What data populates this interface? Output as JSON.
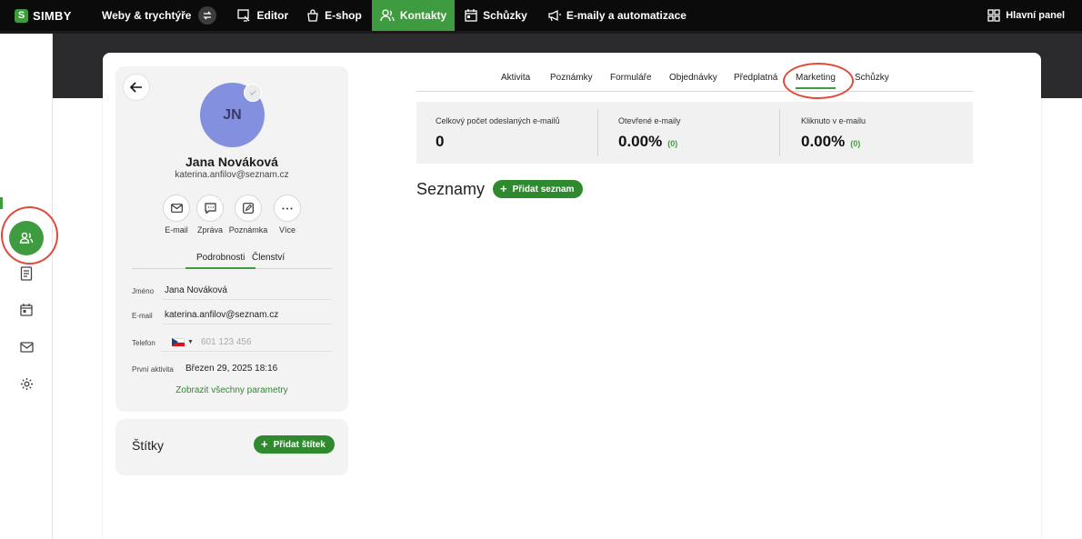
{
  "brand": {
    "name": "SIMBY",
    "badge": "S",
    "accent": "#3f9b3f"
  },
  "topnav": {
    "items": [
      {
        "label": "Weby & trychtýře",
        "icon": "none",
        "active": false
      },
      {
        "label": "Editor",
        "icon": "editor-icon",
        "active": false
      },
      {
        "label": "E-shop",
        "icon": "shopping-bag-icon",
        "active": false
      },
      {
        "label": "Kontakty",
        "icon": "users-icon",
        "active": true
      },
      {
        "label": "Schůzky",
        "icon": "calendar-icon",
        "active": false
      },
      {
        "label": "E-maily a automatizace",
        "icon": "megaphone-icon",
        "active": false
      }
    ],
    "dashboard_label": "Hlavní panel"
  },
  "sidebar": {
    "items": [
      "contacts-icon",
      "document-icon",
      "calendar-icon",
      "mail-icon",
      "gear-icon"
    ]
  },
  "profile": {
    "initials": "JN",
    "name": "Jana Nováková",
    "email": "katerina.anfilov@seznam.cz",
    "actions": [
      {
        "label": "E-mail",
        "icon": "mail-icon"
      },
      {
        "label": "Zpráva",
        "icon": "message-icon"
      },
      {
        "label": "Poznámka",
        "icon": "note-icon"
      },
      {
        "label": "Více",
        "icon": "more-icon"
      }
    ],
    "tabs": {
      "details": "Podrobnosti",
      "membership": "Členství"
    },
    "fields": {
      "name_label": "Jméno",
      "name_value": "Jana Nováková",
      "email_label": "E-mail",
      "email_value": "katerina.anfilov@seznam.cz",
      "phone_label": "Telefon",
      "phone_placeholder": "601 123 456",
      "first_activity_label": "První aktivita",
      "first_activity_value": "Březen 29, 2025 18:16"
    },
    "show_all": "Zobrazit všechny parametry"
  },
  "tags": {
    "title": "Štítky",
    "add_label": "Přidat štítek"
  },
  "tabs": [
    "Aktivita",
    "Poznámky",
    "Formuláře",
    "Objednávky",
    "Předplatná",
    "Marketing",
    "Schůzky"
  ],
  "active_tab": "Marketing",
  "stats": [
    {
      "label": "Celkový počet odeslaných e-mailů",
      "value": "0",
      "sub": ""
    },
    {
      "label": "Otevřené e-maily",
      "value": "0.00%",
      "sub": "(0)"
    },
    {
      "label": "Kliknuto v e-mailu",
      "value": "0.00%",
      "sub": "(0)"
    }
  ],
  "lists": {
    "title": "Seznamy",
    "add_label": "Přidat seznam"
  }
}
